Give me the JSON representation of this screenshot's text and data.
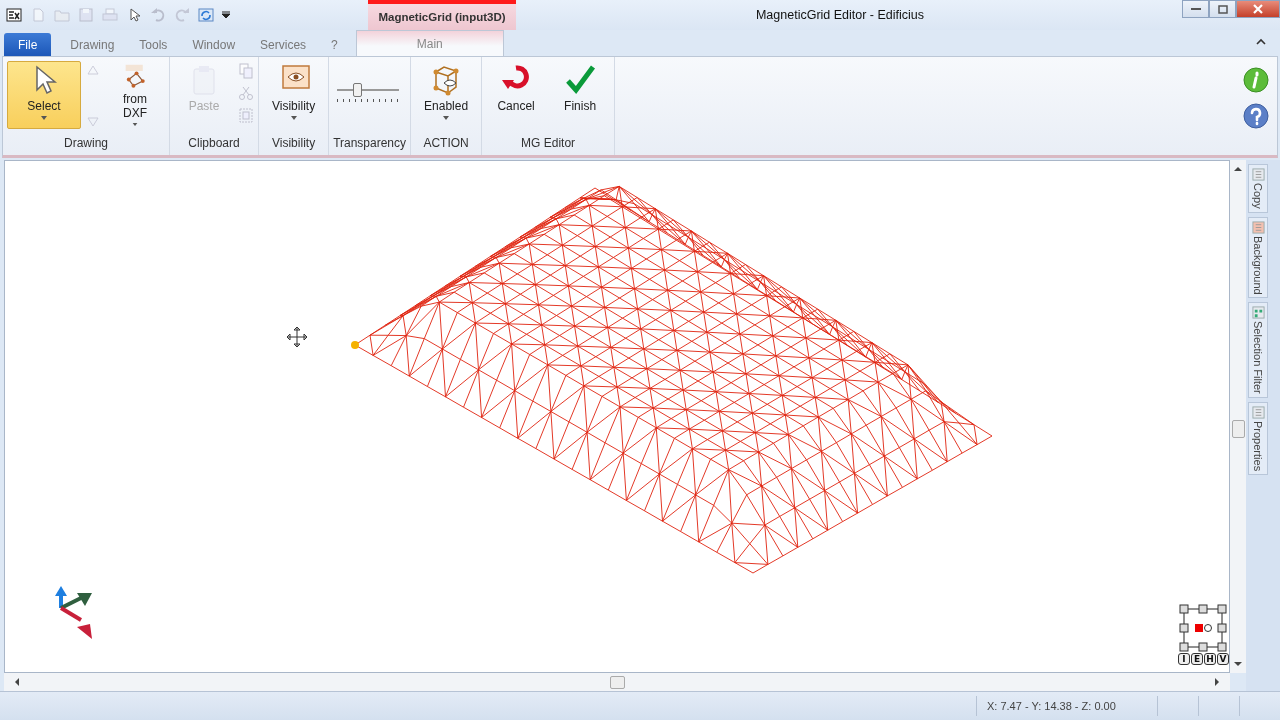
{
  "window": {
    "title": "MagneticGrid Editor - Edificius",
    "contextual_tab": "MagneticGrid (input3D)"
  },
  "tabs": [
    {
      "label": "File",
      "kind": "file",
      "selected": false
    },
    {
      "label": "Drawing",
      "kind": "normal",
      "selected": false
    },
    {
      "label": "Tools",
      "kind": "normal",
      "selected": false
    },
    {
      "label": "Window",
      "kind": "normal",
      "selected": false
    },
    {
      "label": "Services",
      "kind": "normal",
      "selected": false
    },
    {
      "label": "?",
      "kind": "normal",
      "selected": false
    },
    {
      "label": "Main",
      "kind": "contextual",
      "selected": true
    }
  ],
  "ribbon": {
    "groups": [
      {
        "label": "Drawing",
        "buttons": [
          {
            "label": "Select",
            "kind": "large",
            "selected": true,
            "disabled": false,
            "dropdown": true
          },
          {
            "kind": "spinner",
            "disabled": true
          },
          {
            "label": "from\nDXF",
            "kind": "large",
            "selected": false,
            "disabled": false,
            "dropdown": true
          }
        ]
      },
      {
        "label": "Clipboard",
        "buttons": [
          {
            "label": "Paste",
            "kind": "large",
            "selected": false,
            "disabled": true,
            "dropdown": false
          },
          {
            "kind": "small-stack",
            "disabled": true
          }
        ]
      },
      {
        "label": "Visibility",
        "buttons": [
          {
            "label": "Visibility",
            "kind": "large",
            "selected": false,
            "disabled": false,
            "dropdown": true
          }
        ]
      },
      {
        "label": "Transparency",
        "buttons": [
          {
            "kind": "slider",
            "level": 0.3
          }
        ]
      },
      {
        "label": "ACTION",
        "buttons": [
          {
            "label": "Enabled",
            "kind": "large",
            "selected": false,
            "disabled": false,
            "dropdown": true
          }
        ]
      },
      {
        "label": "MG Editor",
        "buttons": [
          {
            "label": "Cancel",
            "kind": "large",
            "selected": false,
            "disabled": false,
            "dropdown": false
          },
          {
            "label": "Finish",
            "kind": "large",
            "selected": false,
            "disabled": false,
            "dropdown": false
          }
        ]
      }
    ]
  },
  "side_tabs": [
    {
      "label": "Copy"
    },
    {
      "label": "Background"
    },
    {
      "label": "Selection Filter"
    },
    {
      "label": "Properties"
    }
  ],
  "view_buttons": [
    "I",
    "E",
    "H",
    "V"
  ],
  "status_bar": {
    "coordinates": "X: 7.47 - Y: 14.38 - Z: 0.00"
  }
}
